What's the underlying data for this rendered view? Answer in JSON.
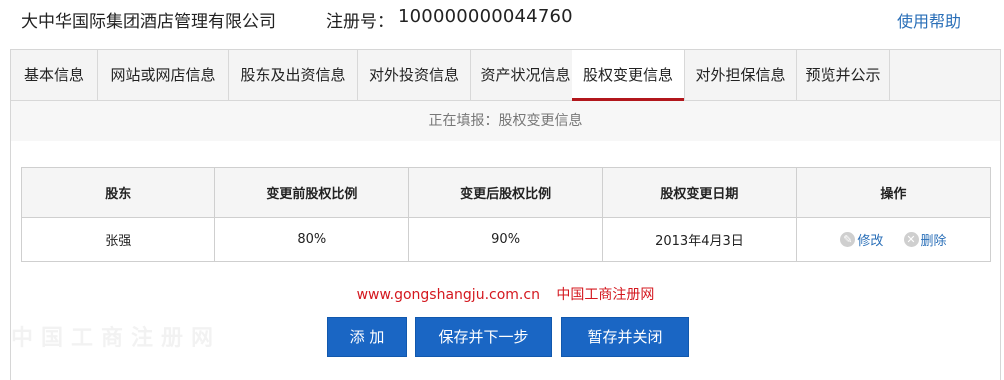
{
  "header": {
    "company_name": "大中华国际集团酒店管理有限公司",
    "reg_label": "注册号：",
    "reg_number": "100000000044760",
    "help_link": "使用帮助"
  },
  "tabs": [
    {
      "label": "基本信息",
      "active": false
    },
    {
      "label": "网站或网店信息",
      "active": false
    },
    {
      "label": "股东及出资信息",
      "active": false
    },
    {
      "label": "对外投资信息",
      "active": false
    },
    {
      "label": "资产状况信息",
      "active": false
    },
    {
      "label": "股权变更信息",
      "active": true
    },
    {
      "label": "对外担保信息",
      "active": false
    },
    {
      "label": "预览并公示",
      "active": false
    }
  ],
  "status_text": "正在填报：股权变更信息",
  "table": {
    "headers": [
      "股东",
      "变更前股权比例",
      "变更后股权比例",
      "股权变更日期",
      "操作"
    ],
    "rows": [
      {
        "shareholder": "张强",
        "before": "80%",
        "after": "90%",
        "date": "2013年4月3日",
        "edit_label": "修改",
        "delete_label": "删除"
      }
    ]
  },
  "footnote": {
    "url": "www.gongshangju.com.cn",
    "site_name": "中国工商注册网"
  },
  "watermark": "中国工商注册网",
  "buttons": {
    "add": "添 加",
    "save_next": "保存并下一步",
    "save_close": "暂存并关闭"
  },
  "colors": {
    "accent_blue": "#1a66c4",
    "active_tab_underline": "#b2171c",
    "link_blue": "#2a6fb8",
    "footnote_red": "#d4181f"
  }
}
